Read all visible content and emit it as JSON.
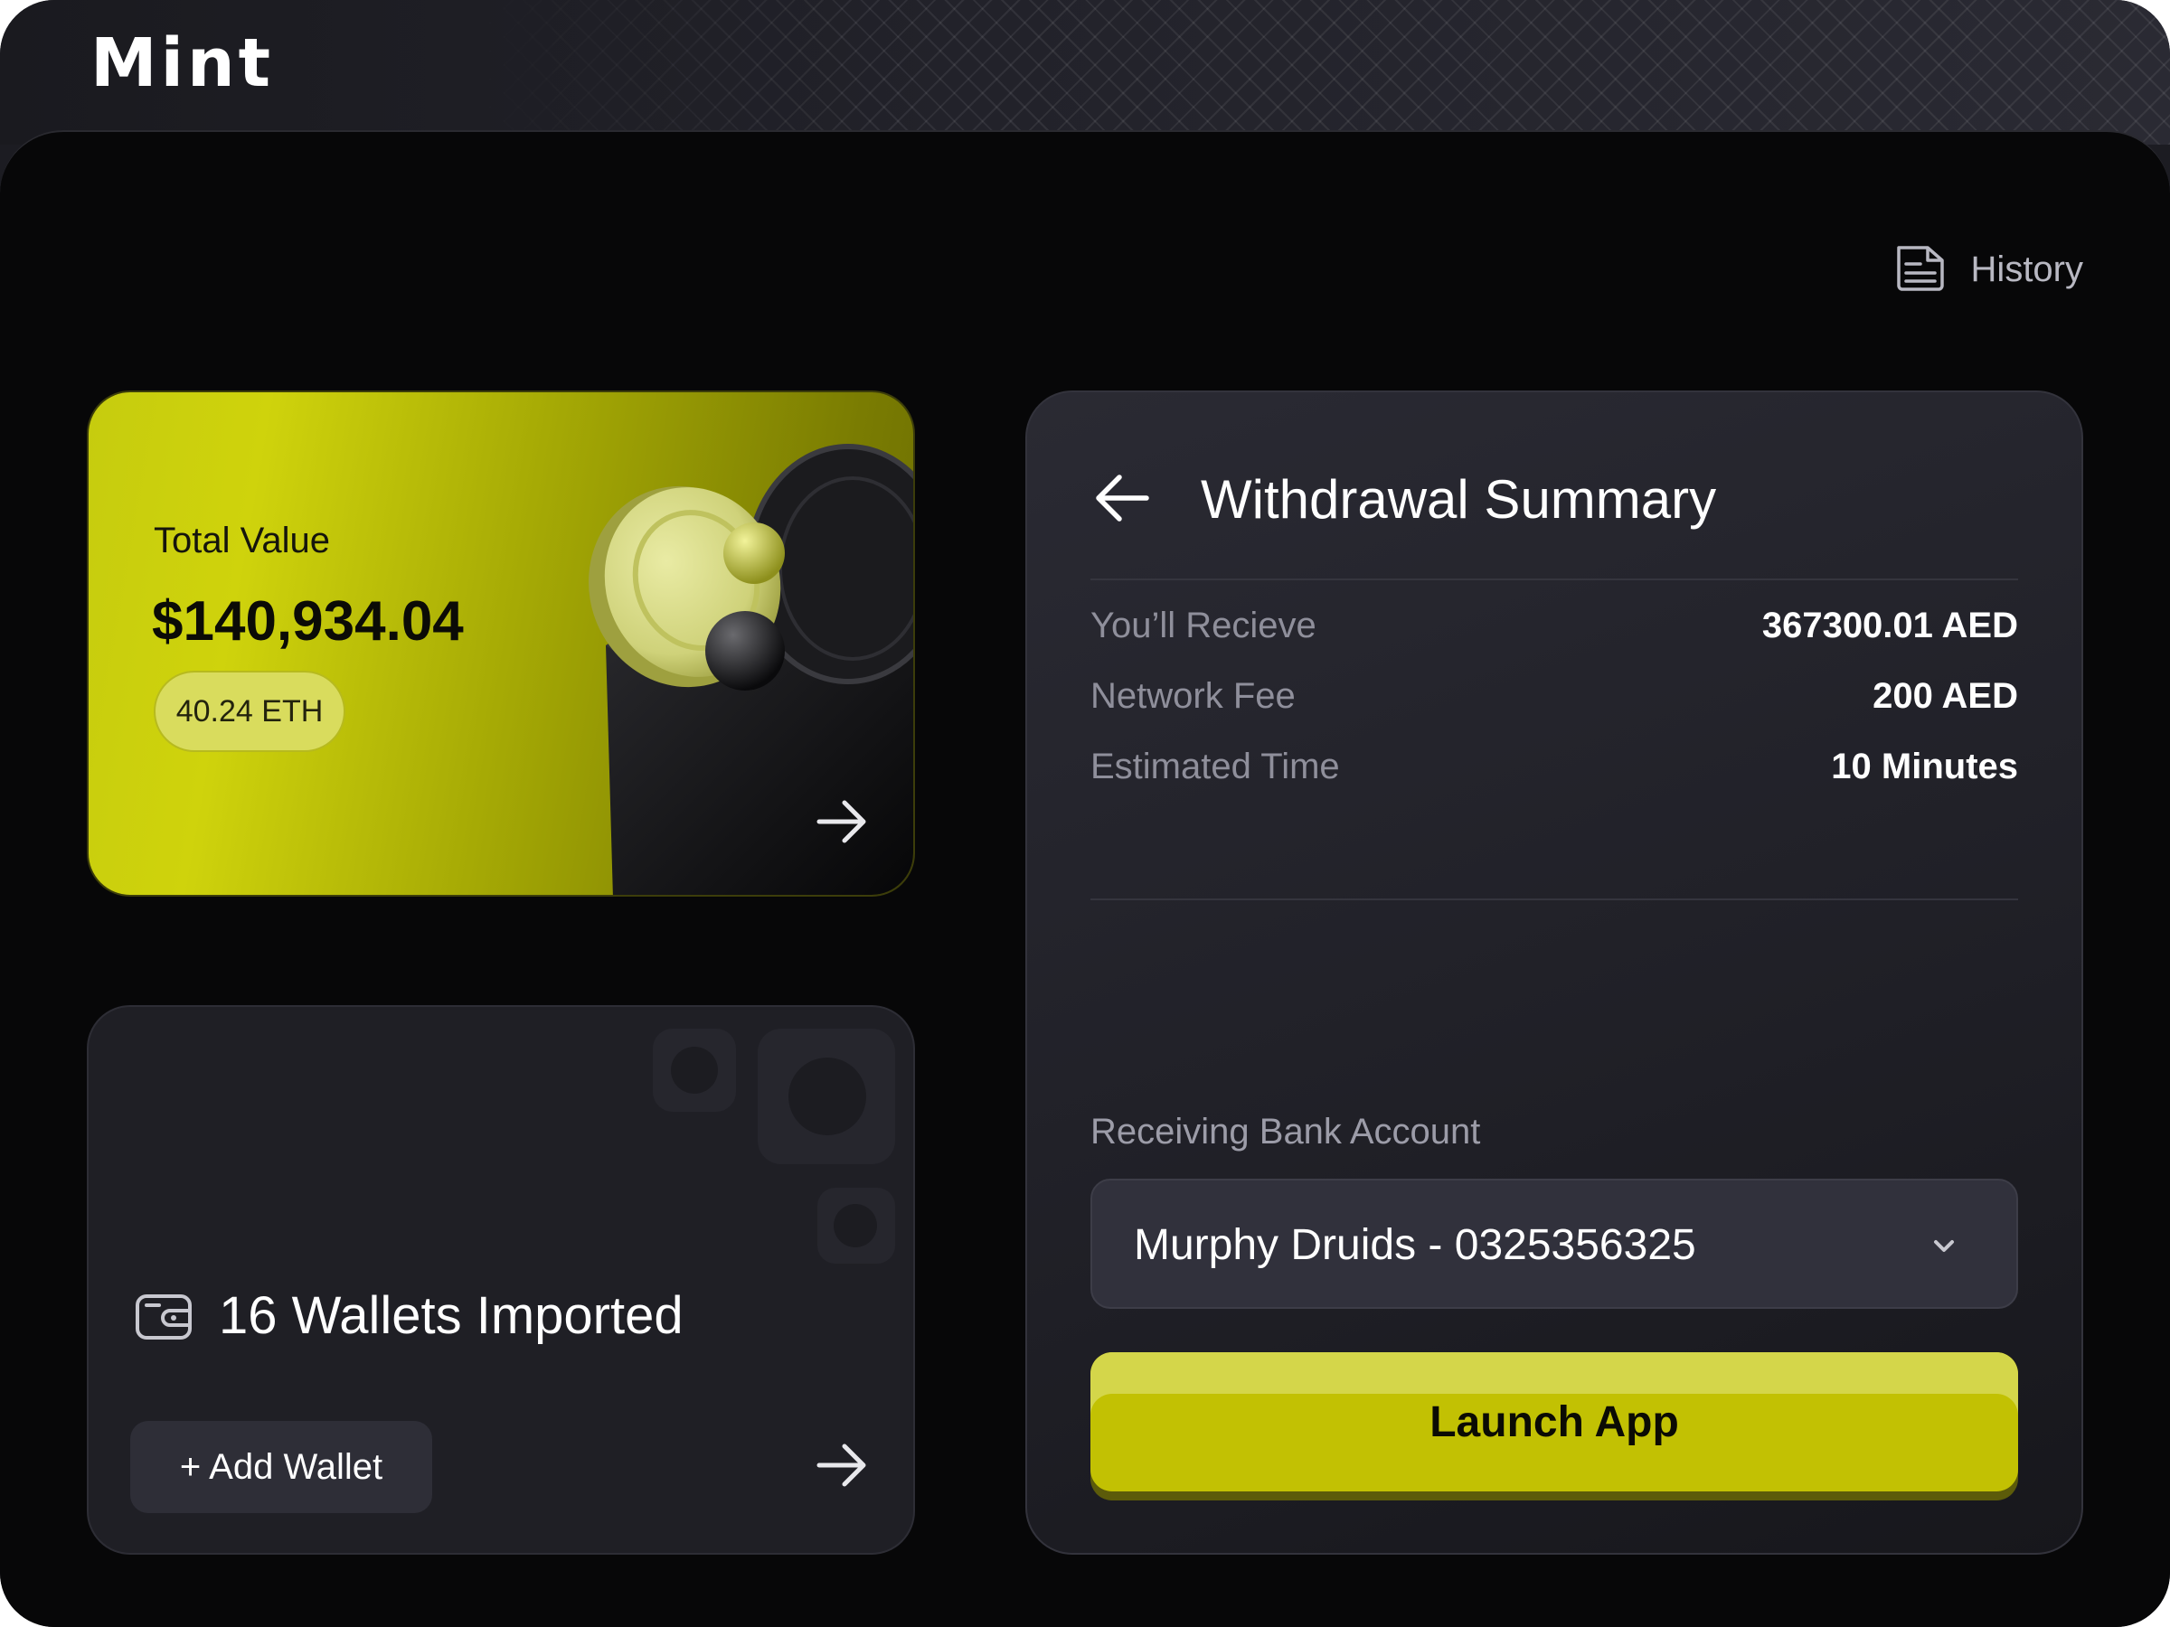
{
  "app": {
    "name": "Mint"
  },
  "header": {
    "history_label": "History"
  },
  "total_value_card": {
    "label": "Total Value",
    "amount": "$140,934.04",
    "eth_badge": "40.24 ETH"
  },
  "wallets_card": {
    "title": "16 Wallets Imported",
    "add_wallet_label": "+ Add Wallet"
  },
  "withdrawal_summary": {
    "title": "Withdrawal Summary",
    "rows": [
      {
        "label": "You’ll Recieve",
        "value": "367300.01 AED"
      },
      {
        "label": "Network Fee",
        "value": "200 AED"
      },
      {
        "label": "Estimated Time",
        "value": "10 Minutes"
      }
    ],
    "bank_account_label": "Receiving Bank Account",
    "bank_account_selected": "Murphy Druids - 0325356325",
    "launch_button_label": "Launch App"
  },
  "colors": {
    "accent": "#c2c103",
    "accent_light": "#d4d64a",
    "background": "#070708",
    "card": "#1f1f25",
    "muted_text": "#8f8f9b"
  },
  "icons": [
    "history-document-icon",
    "arrow-right-icon",
    "wallet-icon",
    "arrow-left-icon",
    "chevron-down-icon",
    "coin-safe-illustration"
  ]
}
